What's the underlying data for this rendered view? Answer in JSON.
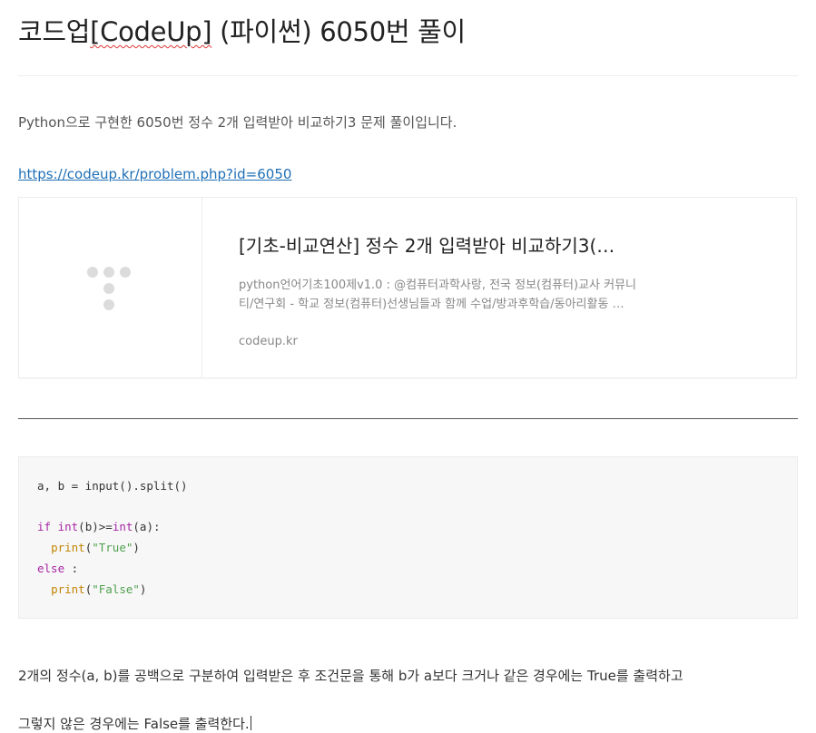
{
  "post": {
    "title_prefix": "코드업",
    "title_misspelled": "[CodeUp]",
    "title_suffix": " (파이썬) 6050번 풀이",
    "intro": "Python으로 구현한 6050번 정수 2개 입력받아 비교하기3 문제 풀이입니다.",
    "link_url_text": "https://codeup.kr/problem.php?id=6050"
  },
  "link_card": {
    "title": "[기초-비교연산] 정수 2개 입력받아 비교하기3(…",
    "description_line1": "python언어기초100제v1.0 : @컴퓨터과학사랑, 전국 정보(컴퓨터)교사 커뮤니",
    "description_line2": "티/연구회 - 학교 정보(컴퓨터)선생님들과 함께 수업/방과후학습/동아리활동 …",
    "host": "codeup.kr",
    "thumbnail_icon": "placeholder-logo-dots"
  },
  "code": {
    "line1": "a, b = input().split()",
    "line2_kw": "if",
    "line2_fn1": "int",
    "line2_mid": "(b)>=",
    "line2_fn2": "int",
    "line2_end": "(a):",
    "line3_fn": "print",
    "line3_open": "(",
    "line3_str": "\"True\"",
    "line3_close": ")",
    "line4_kw": "else",
    "line4_end": " :",
    "line5_fn": "print",
    "line5_open": "(",
    "line5_str": "\"False\"",
    "line5_close": ")"
  },
  "body": {
    "explanation": "2개의 정수(a, b)를 공백으로 구분하여 입력받은 후 조건문을 통해 b가 a보다 크거나 같은 경우에는 True를 출력하고",
    "cut_off_line": "그렇지 않은 경우에는 False를 출력한다."
  },
  "colors": {
    "link": "#1f6fb5",
    "keyword": "#a626a4",
    "builtin": "#c18401",
    "string": "#50a14f",
    "code_background": "#f7f7f7"
  }
}
